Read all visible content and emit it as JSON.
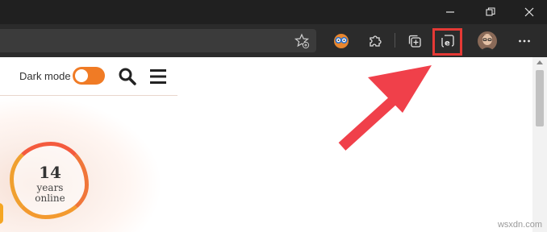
{
  "browser": {
    "window_controls": {
      "minimize_icon": "minimize-icon",
      "restore_icon": "restore-icon",
      "close_icon": "close-icon"
    },
    "toolbar": {
      "icons": [
        "favorites-star-icon",
        "extension-glasses-icon",
        "extensions-puzzle-icon",
        "collections-icon",
        "ie-mode-icon",
        "profile-avatar",
        "more-options-icon"
      ],
      "highlighted_icon": "ie-mode-icon"
    }
  },
  "site": {
    "dark_mode_label": "Dark mode",
    "years_number": "14",
    "years_text_line1": "years",
    "years_text_line2": "online",
    "accent_color": "#f07b25"
  },
  "annotation": {
    "arrow_color": "#f0404a",
    "highlight_color": "#e53935"
  },
  "watermark": "wsxdn.com"
}
